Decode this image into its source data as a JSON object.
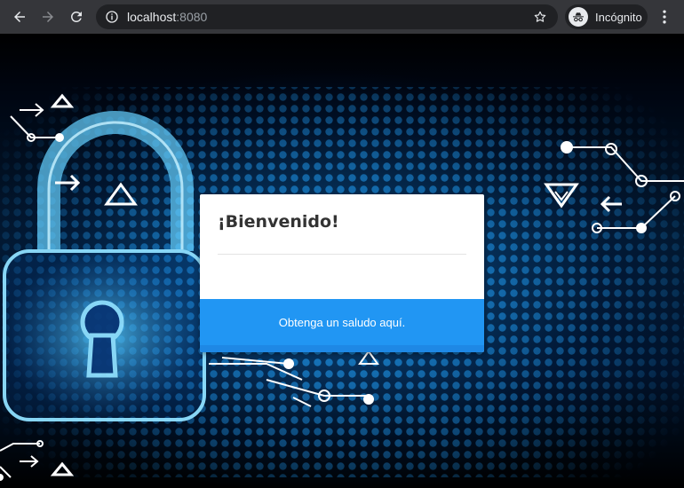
{
  "browser": {
    "url_host": "localhost",
    "url_port": ":8080",
    "profile_label": "Incógnito"
  },
  "icons": {
    "back": "arrow-left-icon",
    "forward": "arrow-right-icon",
    "reload": "reload-icon",
    "info": "info-icon",
    "star": "star-icon",
    "incognito": "incognito-icon",
    "menu": "kebab-menu-icon"
  },
  "card": {
    "title": "¡Bienvenido!",
    "action_label": "Obtenga un saludo aquí."
  },
  "colors": {
    "accent": "#2196f3",
    "chrome": "#35363a",
    "omnibox": "#202124"
  }
}
